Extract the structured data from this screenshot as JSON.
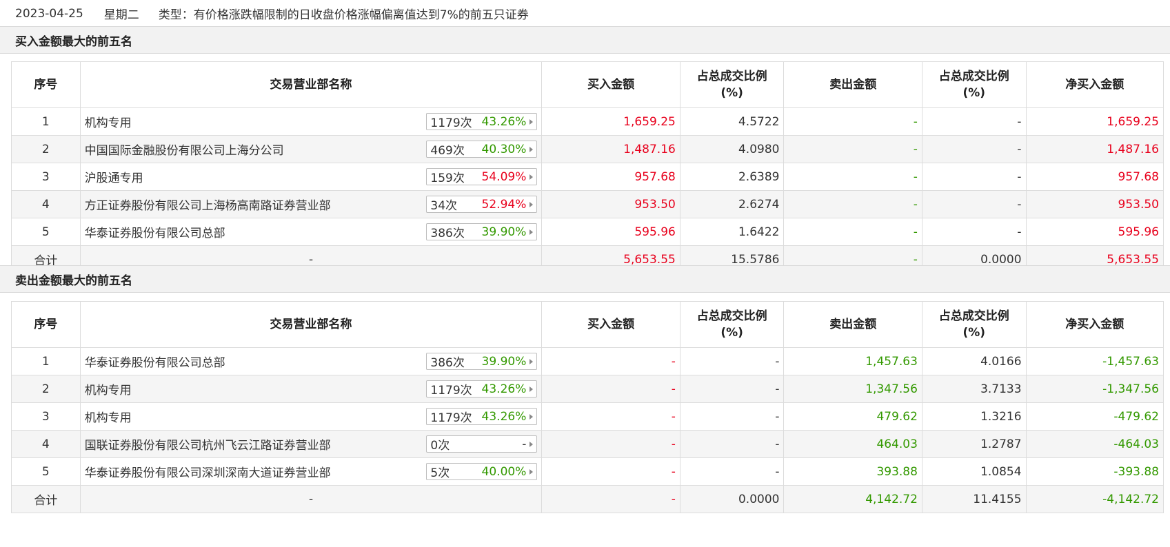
{
  "header": {
    "date": "2023-04-25",
    "weekday": "星期二",
    "type_text": "类型：有价格涨跌幅限制的日收盘价格涨幅偏离值达到7%的前五只证券"
  },
  "columns": [
    "序号",
    "交易营业部名称",
    "买入金额",
    "占总成交比例\n(%)",
    "卖出金额",
    "占总成交比例\n(%)",
    "净买入金额"
  ],
  "colors": {
    "red": "#e8001c",
    "green": "#339900",
    "gray": "#333333"
  },
  "buy_section": {
    "title": "买入金额最大的前五名",
    "rows": [
      {
        "idx": "1",
        "name": "机构专用",
        "times": "1179次",
        "rate": "43.26%",
        "rate_color": "green",
        "buy": "1,659.25",
        "buy_pct": "4.5722",
        "sell": "-",
        "sell_pct": "-",
        "net": "1,659.25",
        "net_color": "red"
      },
      {
        "idx": "2",
        "name": "中国国际金融股份有限公司上海分公司",
        "times": "469次",
        "rate": "40.30%",
        "rate_color": "green",
        "buy": "1,487.16",
        "buy_pct": "4.0980",
        "sell": "-",
        "sell_pct": "-",
        "net": "1,487.16",
        "net_color": "red"
      },
      {
        "idx": "3",
        "name": "沪股通专用",
        "times": "159次",
        "rate": "54.09%",
        "rate_color": "red",
        "buy": "957.68",
        "buy_pct": "2.6389",
        "sell": "-",
        "sell_pct": "-",
        "net": "957.68",
        "net_color": "red"
      },
      {
        "idx": "4",
        "name": "方正证券股份有限公司上海杨高南路证券营业部",
        "times": "34次",
        "rate": "52.94%",
        "rate_color": "red",
        "buy": "953.50",
        "buy_pct": "2.6274",
        "sell": "-",
        "sell_pct": "-",
        "net": "953.50",
        "net_color": "red"
      },
      {
        "idx": "5",
        "name": "华泰证券股份有限公司总部",
        "times": "386次",
        "rate": "39.90%",
        "rate_color": "green",
        "buy": "595.96",
        "buy_pct": "1.6422",
        "sell": "-",
        "sell_pct": "-",
        "net": "595.96",
        "net_color": "red"
      }
    ],
    "total": {
      "label": "合计",
      "name": "-",
      "buy": "5,653.55",
      "buy_pct": "15.5786",
      "sell": "-",
      "sell_pct": "0.0000",
      "net": "5,653.55",
      "net_color": "red"
    }
  },
  "sell_section": {
    "title": "卖出金额最大的前五名",
    "rows": [
      {
        "idx": "1",
        "name": "华泰证券股份有限公司总部",
        "times": "386次",
        "rate": "39.90%",
        "rate_color": "green",
        "buy": "-",
        "buy_pct": "-",
        "sell": "1,457.63",
        "sell_pct": "4.0166",
        "net": "-1,457.63",
        "net_color": "green"
      },
      {
        "idx": "2",
        "name": "机构专用",
        "times": "1179次",
        "rate": "43.26%",
        "rate_color": "green",
        "buy": "-",
        "buy_pct": "-",
        "sell": "1,347.56",
        "sell_pct": "3.7133",
        "net": "-1,347.56",
        "net_color": "green"
      },
      {
        "idx": "3",
        "name": "机构专用",
        "times": "1179次",
        "rate": "43.26%",
        "rate_color": "green",
        "buy": "-",
        "buy_pct": "-",
        "sell": "479.62",
        "sell_pct": "1.3216",
        "net": "-479.62",
        "net_color": "green"
      },
      {
        "idx": "4",
        "name": "国联证券股份有限公司杭州飞云江路证券营业部",
        "times": "0次",
        "rate": "-",
        "rate_color": "gray",
        "buy": "-",
        "buy_pct": "-",
        "sell": "464.03",
        "sell_pct": "1.2787",
        "net": "-464.03",
        "net_color": "green"
      },
      {
        "idx": "5",
        "name": "华泰证券股份有限公司深圳深南大道证券营业部",
        "times": "5次",
        "rate": "40.00%",
        "rate_color": "green",
        "buy": "-",
        "buy_pct": "-",
        "sell": "393.88",
        "sell_pct": "1.0854",
        "net": "-393.88",
        "net_color": "green"
      }
    ],
    "total": {
      "label": "合计",
      "name": "-",
      "buy": "-",
      "buy_pct": "0.0000",
      "sell": "4,142.72",
      "sell_pct": "11.4155",
      "net": "-4,142.72",
      "net_color": "green"
    }
  }
}
